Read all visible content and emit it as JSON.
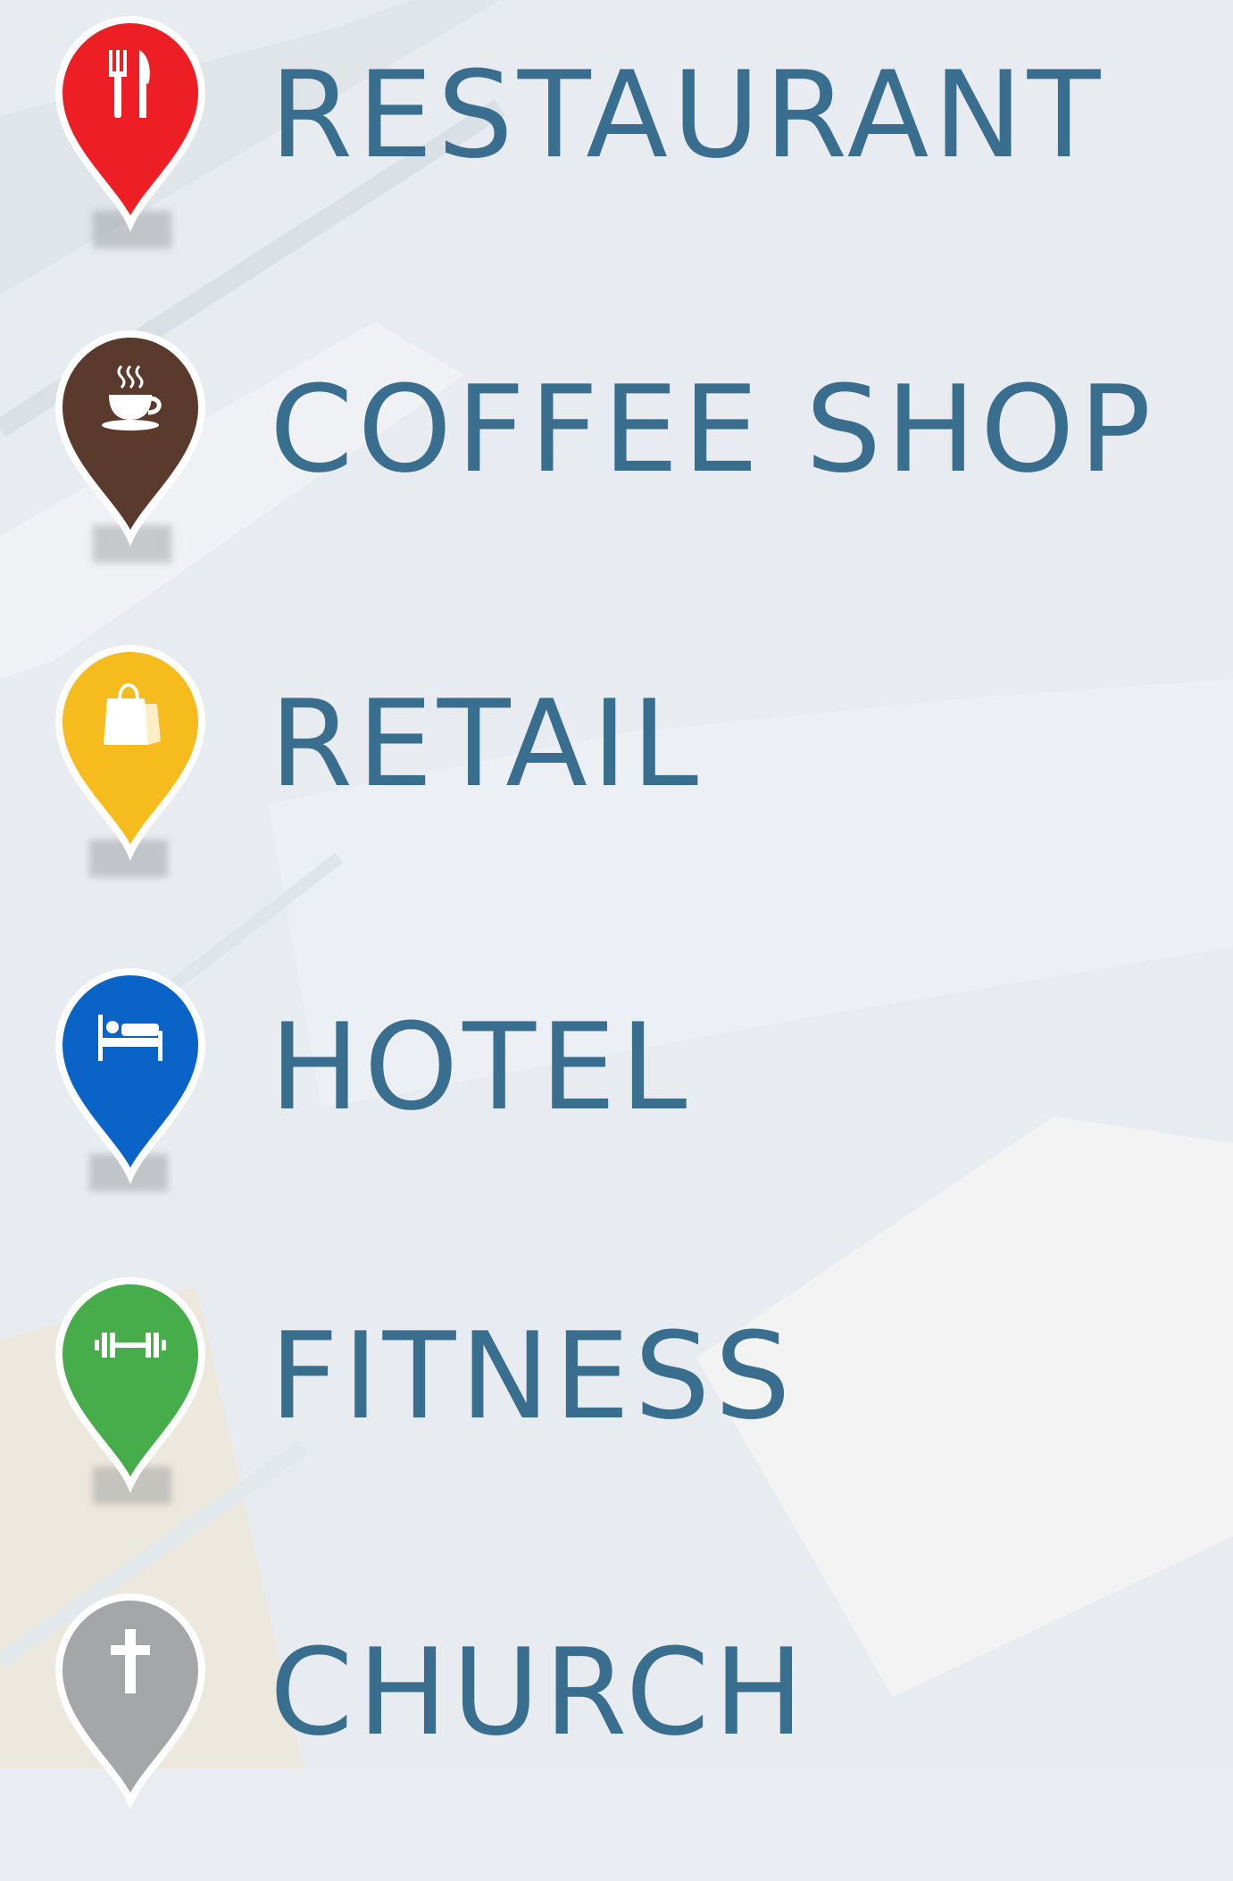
{
  "map": {
    "label_color": "#3a6e8f",
    "categories": [
      {
        "label": "RESTAURANT",
        "color": "#ee1f24",
        "icon": "fork-knife-icon"
      },
      {
        "label": "COFFEE SHOP",
        "color": "#5b3a2e",
        "icon": "coffee-cup-icon"
      },
      {
        "label": "RETAIL",
        "color": "#f6bb1c",
        "icon": "shopping-bag-icon"
      },
      {
        "label": "HOTEL",
        "color": "#0a64c8",
        "icon": "bed-icon"
      },
      {
        "label": "FITNESS",
        "color": "#47ad4b",
        "icon": "dumbbell-icon"
      },
      {
        "label": "CHURCH",
        "color": "#a4a6a8",
        "icon": "cross-icon"
      }
    ]
  }
}
